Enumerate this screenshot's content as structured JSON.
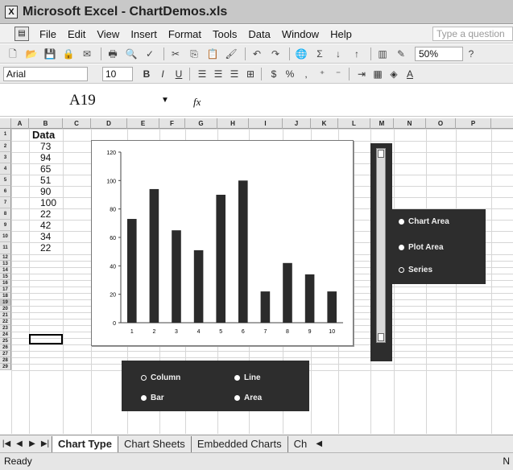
{
  "window": {
    "title": "Microsoft Excel - ChartDemos.xls",
    "app_icon": "excel-icon"
  },
  "menubar": {
    "items": [
      "File",
      "Edit",
      "View",
      "Insert",
      "Format",
      "Tools",
      "Data",
      "Window",
      "Help"
    ],
    "help_placeholder": "Type a question"
  },
  "toolbar": {
    "zoom": "50%"
  },
  "formatting": {
    "font": "Arial",
    "size": "10"
  },
  "formula_bar": {
    "name_box": "A19",
    "fx": "fx"
  },
  "columns": [
    "A",
    "B",
    "C",
    "D",
    "E",
    "F",
    "G",
    "H",
    "I",
    "J",
    "K",
    "L",
    "M",
    "N",
    "O",
    "P"
  ],
  "rows": [
    "1",
    "2",
    "3",
    "4",
    "5",
    "6",
    "7",
    "8",
    "9",
    "10",
    "11",
    "12",
    "13",
    "14",
    "15",
    "16",
    "17",
    "18",
    "19",
    "20",
    "21",
    "22",
    "23",
    "24",
    "25",
    "26",
    "27",
    "28",
    "29"
  ],
  "sheet_data": {
    "header": "Data",
    "values": [
      "73",
      "94",
      "65",
      "51",
      "90",
      "100",
      "22",
      "42",
      "34",
      "22"
    ]
  },
  "chart_data": {
    "type": "bar",
    "categories": [
      "1",
      "2",
      "3",
      "4",
      "5",
      "6",
      "7",
      "8",
      "9",
      "10"
    ],
    "values": [
      73,
      94,
      65,
      51,
      90,
      100,
      22,
      42,
      34,
      22
    ],
    "ylim": [
      0,
      120
    ],
    "yticks": [
      "0",
      "20",
      "40",
      "60",
      "80",
      "100",
      "120"
    ],
    "bar_color": "#2b2b2b",
    "grid": false,
    "legend": "none"
  },
  "chart_type_options": [
    {
      "label": "Column",
      "selected": false
    },
    {
      "label": "Line",
      "selected": true
    },
    {
      "label": "Bar",
      "selected": true
    },
    {
      "label": "Area",
      "selected": true
    }
  ],
  "element_options": [
    {
      "label": "Chart Area",
      "selected": true
    },
    {
      "label": "Plot Area",
      "selected": true
    },
    {
      "label": "Series",
      "selected": false
    }
  ],
  "tabs": [
    "Chart Type",
    "Chart Sheets",
    "Embedded Charts",
    "Ch"
  ],
  "status": {
    "text": "Ready",
    "right": "N"
  },
  "colors": {
    "panel": "#2d2d2d",
    "titlebar": "#c8c8c8",
    "grid": "#d6d6d6"
  }
}
